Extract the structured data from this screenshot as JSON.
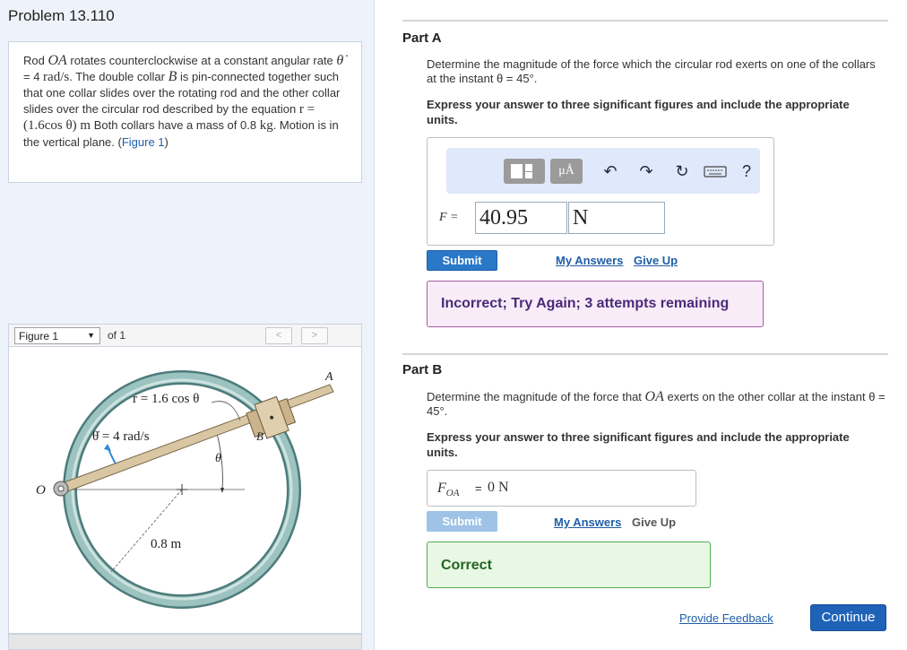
{
  "problem": {
    "title": "Problem 13.110",
    "statement": {
      "t1": "Rod ",
      "rod": "OA",
      "t2": " rotates counterclockwise at a constant angular rate ",
      "thetadot": "θ̇",
      "t3": " = 4 ",
      "rate_units": "rad/s",
      "t4": ". The double collar ",
      "collar": "B",
      "t5": " is pin-connected together such that one collar slides over the rotating rod and the other collar slides over the circular rod described by the equation ",
      "req": "r = (1.6cos θ) m",
      "t6": " Both collars have a mass of 0.8 ",
      "kg": "kg",
      "t7": ". Motion is in the vertical plane. (",
      "figlink": "Figure 1",
      "t8": ")"
    },
    "figure_nav": {
      "select": "Figure 1",
      "of": "of 1",
      "prev": "<",
      "next": ">"
    },
    "figure": {
      "eq_label": "r = 1.6 cos θ",
      "rate_label": "θ̇ = 4 rad/s",
      "label_A": "A",
      "label_B": "B",
      "label_O": "O",
      "label_theta": "θ",
      "radius_label": "0.8 m"
    }
  },
  "partA": {
    "title": "Part A",
    "question": "Determine the magnitude of the force which the circular rod exerts on one of the collars at the instant θ = 45°.",
    "instruction": "Express your answer to three significant figures and include the appropriate units.",
    "toolbar": {
      "units_btn": "μÅ",
      "help": "?"
    },
    "label": "F =",
    "value": "40.95",
    "units": "N",
    "submit": "Submit",
    "my_answers": "My Answers",
    "give_up": "Give Up",
    "feedback": "Incorrect; Try Again; 3 attempts remaining"
  },
  "partB": {
    "title": "Part B",
    "q1": "Determine the magnitude of the force that ",
    "q_rod": "OA",
    "q2": " exerts on the other collar at the instant θ = 45°.",
    "instruction": "Express your answer to three significant figures and include the appropriate units.",
    "label_main": "F",
    "label_sub": "OA",
    "eq": "=",
    "answer": "0 N",
    "submit": "Submit",
    "my_answers": "My Answers",
    "give_up": "Give Up",
    "feedback": "Correct"
  },
  "footer": {
    "feedback_link": "Provide Feedback",
    "continue": "Continue"
  }
}
